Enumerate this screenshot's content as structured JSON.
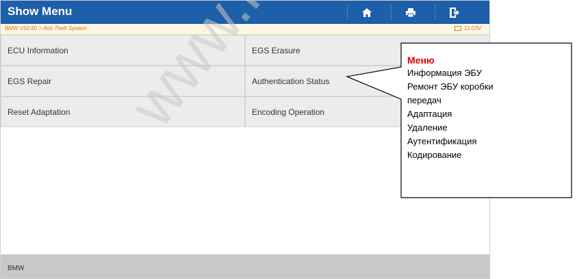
{
  "header": {
    "title": "Show Menu",
    "home_icon": "home-icon",
    "print_icon": "print-icon",
    "exit_icon": "exit-icon"
  },
  "pathbar": {
    "path": "BMW V50.60 > Anti-Theft System",
    "voltage": "12.03V",
    "battery_icon": "battery-icon"
  },
  "menu": {
    "items": [
      {
        "label": "ECU Information"
      },
      {
        "label": "EGS Erasure"
      },
      {
        "label": "EGS Repair"
      },
      {
        "label": "Authentication Status"
      },
      {
        "label": "Reset Adaptation"
      },
      {
        "label": "Encoding Operation"
      }
    ]
  },
  "footer": {
    "label": "BMW"
  },
  "watermark": {
    "text": "www.launch"
  },
  "callout": {
    "title": "Меню",
    "lines": [
      "Информация ЭБУ",
      "Ремонт ЭБУ коробки",
      "передач",
      "Адаптация",
      "Удаление",
      "Аутентификация",
      "Кодирование"
    ]
  },
  "colors": {
    "titlebar": "#1d5fa8",
    "path_text": "#e2721a",
    "callout_title": "#e00000"
  }
}
